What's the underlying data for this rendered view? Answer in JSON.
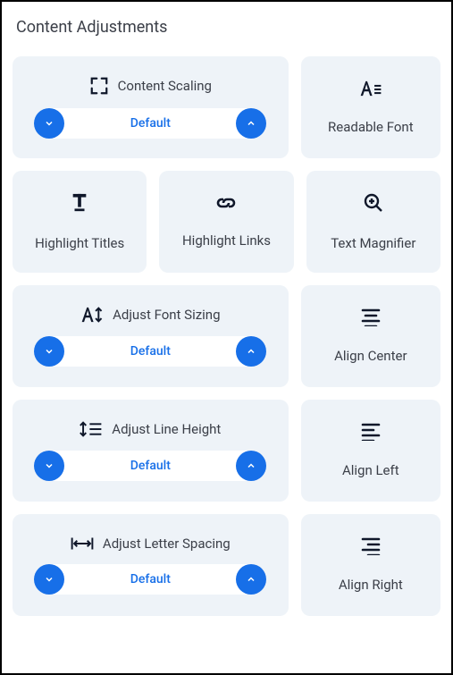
{
  "section_title": "Content Adjustments",
  "cards": {
    "content_scaling": {
      "label": "Content Scaling",
      "value": "Default"
    },
    "readable_font": {
      "label": "Readable Font"
    },
    "highlight_titles": {
      "label": "Highlight Titles"
    },
    "highlight_links": {
      "label": "Highlight Links"
    },
    "text_magnifier": {
      "label": "Text Magnifier"
    },
    "font_sizing": {
      "label": "Adjust Font Sizing",
      "value": "Default"
    },
    "align_center": {
      "label": "Align Center"
    },
    "line_height": {
      "label": "Adjust Line Height",
      "value": "Default"
    },
    "align_left": {
      "label": "Align Left"
    },
    "letter_spacing": {
      "label": "Adjust Letter Spacing",
      "value": "Default"
    },
    "align_right": {
      "label": "Align Right"
    }
  }
}
